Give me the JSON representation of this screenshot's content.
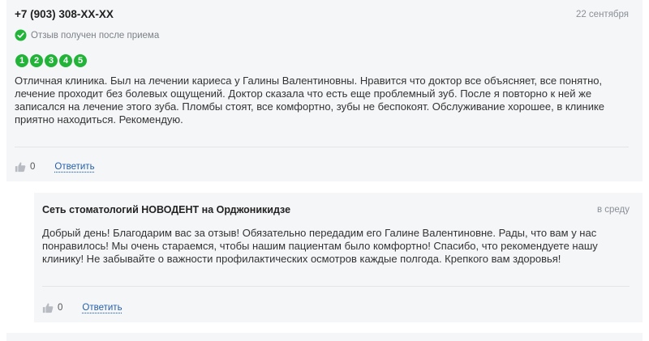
{
  "review": {
    "author": "+7 (903) 308-XX-XX",
    "date": "22 сентября",
    "verified_text": "Отзыв получен после приема",
    "rating": [
      "1",
      "2",
      "3",
      "4",
      "5"
    ],
    "text": "Отличная клиника. Был на лечении кариеса у Галины Валентиновны. Нравится что доктор все объясняет, все понятно, лечение проходит без болевых ощущений. Доктор сказала что есть еще проблемный зуб. После я повторно к ней же записался на лечение этого зуба. Пломбы стоят, все комфортно, зубы не беспокоят. Обслуживание хорошее, в клинике приятно находиться. Рекомендую.",
    "likes": "0",
    "reply_label": "Ответить"
  },
  "answer": {
    "author": "Сеть стоматологий НОВОДЕНТ на Орджоникидзе",
    "date": "в среду",
    "text": "Добрый день! Благодарим вас за отзыв! Обязательно передадим его Галине Валентиновне. Рады, что вам у нас понравилось! Мы очень стараемся, чтобы нашим пациентам было комфортно! Спасибо, что рекомендуете нашу клинику! Не забывайте о важности профилактических осмотров каждые полгода. Крепкого вам здоровья!",
    "likes": "0",
    "reply_label": "Ответить"
  },
  "colors": {
    "card_bg": "#f5f6f8",
    "rating_green": "#22b339",
    "link_blue": "#245fa8",
    "muted_text": "#8a8f96"
  },
  "icons": [
    "check-circle-icon",
    "thumb-up-icon"
  ]
}
